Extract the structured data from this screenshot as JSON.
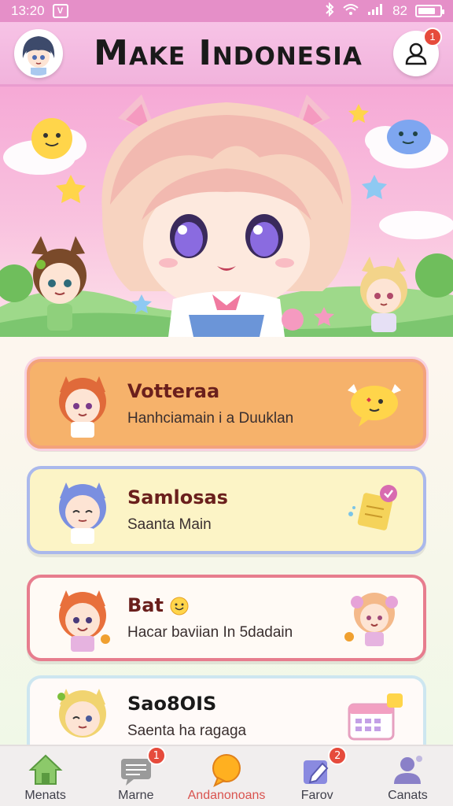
{
  "status_bar": {
    "time": "13:20",
    "app_icon": "V",
    "indicators": [
      "bluetooth-icon",
      "wifi-icon",
      "signal-icon"
    ],
    "battery_text": "82",
    "battery_level": 0.82
  },
  "header": {
    "title": "Make Indonesia",
    "notification_count": "1"
  },
  "cards": [
    {
      "title": "Votteraa",
      "subtitle": "Hanhciamain i a Duuklan",
      "icon": "chat-bubble-icon"
    },
    {
      "title": "Samlosas",
      "subtitle": "Saanta Main",
      "icon": "note-icon"
    },
    {
      "title": "Bat",
      "subtitle": "Hacar baviian In 5dadain",
      "icon": "smiley-icon"
    },
    {
      "title": "Sao8OIS",
      "subtitle": "Saenta ha ragaga",
      "icon": "calendar-icon"
    }
  ],
  "tabs": [
    {
      "label": "Menats",
      "icon": "home-icon",
      "badge": ""
    },
    {
      "label": "Marne",
      "icon": "message-icon",
      "badge": "1"
    },
    {
      "label": "Andanonoans",
      "icon": "chat-icon",
      "badge": "",
      "active": true
    },
    {
      "label": "Farov",
      "icon": "edit-icon",
      "badge": "2"
    },
    {
      "label": "Canats",
      "icon": "profile-icon",
      "badge": ""
    }
  ],
  "colors": {
    "header_bg": "#f1b3dc",
    "status_bar": "#e58fc8",
    "card1_bg": "#f6b26b",
    "card2_bg": "#fcf4c6",
    "card3_bg": "#fffaf5",
    "badge_red": "#e64b3c",
    "active_tab": "#d9534f"
  }
}
